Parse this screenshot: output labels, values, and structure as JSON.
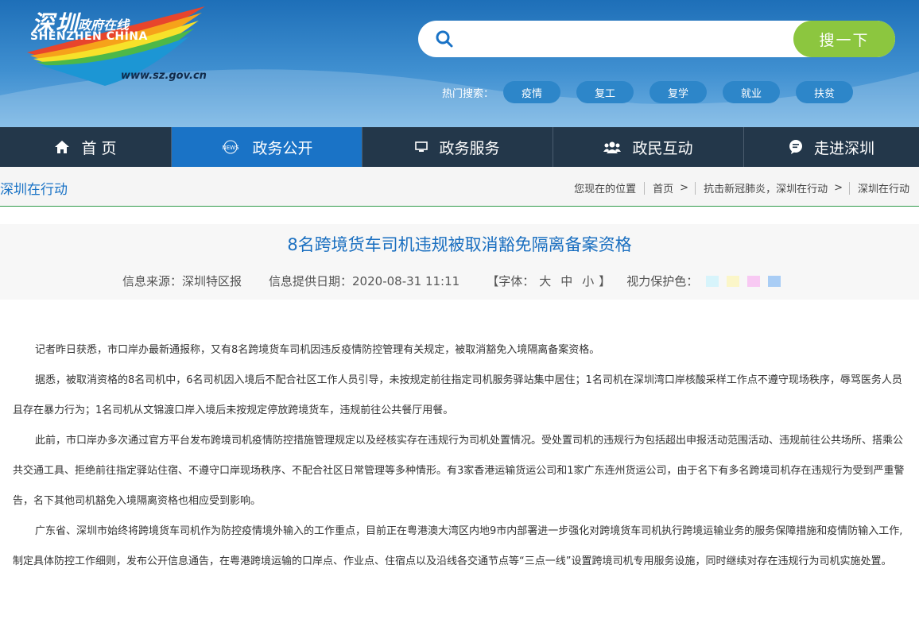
{
  "header": {
    "logo_cn": "深圳",
    "logo_cn2": "政府在线",
    "logo_en": "SHENZHEN  CHINA",
    "logo_url": "www.sz.gov.cn",
    "search_placeholder": "",
    "search_button": "搜一下",
    "hot_label": "热门搜索：",
    "hot_tags": [
      "疫情",
      "复工",
      "复学",
      "就业",
      "扶贫"
    ]
  },
  "nav": {
    "items": [
      {
        "label": "首 页",
        "icon": "home-icon"
      },
      {
        "label": "政务公开",
        "icon": "news-icon"
      },
      {
        "label": "政务服务",
        "icon": "monitor-icon"
      },
      {
        "label": "政民互动",
        "icon": "people-icon"
      },
      {
        "label": "走进深圳",
        "icon": "chat-icon"
      }
    ],
    "active_index": 1
  },
  "breadcrumb": {
    "section_title": "深圳在行动",
    "location_label": "您现在的位置",
    "items": [
      "首页",
      "抗击新冠肺炎，深圳在行动",
      "深圳在行动"
    ]
  },
  "article": {
    "title": "8名跨境货车司机违规被取消豁免隔离备案资格",
    "source": "信息来源：深圳特区报",
    "date": "信息提供日期：2020-08-31 11:11",
    "font_label": "【字体：",
    "font_large": "大",
    "font_medium": "中",
    "font_small": "小",
    "font_close": "】",
    "eye_label": "视力保护色：",
    "eye_colors": [
      "#d7f4fb",
      "#fbf6c8",
      "#f8c9f3",
      "#a9cdf5"
    ],
    "paragraphs": [
      "记者昨日获悉，市口岸办最新通报称，又有8名跨境货车司机因违反疫情防控管理有关规定，被取消豁免入境隔离备案资格。",
      "据悉，被取消资格的8名司机中，6名司机因入境后不配合社区工作人员引导，未按规定前往指定司机服务驿站集中居住；1名司机在深圳湾口岸核酸采样工作点不遵守现场秩序，辱骂医务人员且存在暴力行为；1名司机从文锦渡口岸入境后未按规定停放跨境货车，违规前往公共餐厅用餐。",
      "此前，市口岸办多次通过官方平台发布跨境司机疫情防控措施管理规定以及经核实存在违规行为司机处置情况。受处置司机的违规行为包括超出申报活动范围活动、违规前往公共场所、搭乘公共交通工具、拒绝前往指定驿站住宿、不遵守口岸现场秩序、不配合社区日常管理等多种情形。有3家香港运输货运公司和1家广东连州货运公司，由于名下有多名跨境司机存在违规行为受到严重警告，名下其他司机豁免入境隔离资格也相应受到影响。",
      "广东省、深圳市始终将跨境货车司机作为防控疫情境外输入的工作重点，目前正在粤港澳大湾区内地9市内部署进一步强化对跨境货车司机执行跨境运输业务的服务保障措施和疫情防输入工作,制定具体防控工作细则，发布公开信息通告，在粤港跨境运输的口岸点、作业点、住宿点以及沿线各交通节点等“三点一线”设置跨境司机专用服务设施，同时继续对存在违规行为司机实施处置。"
    ]
  }
}
